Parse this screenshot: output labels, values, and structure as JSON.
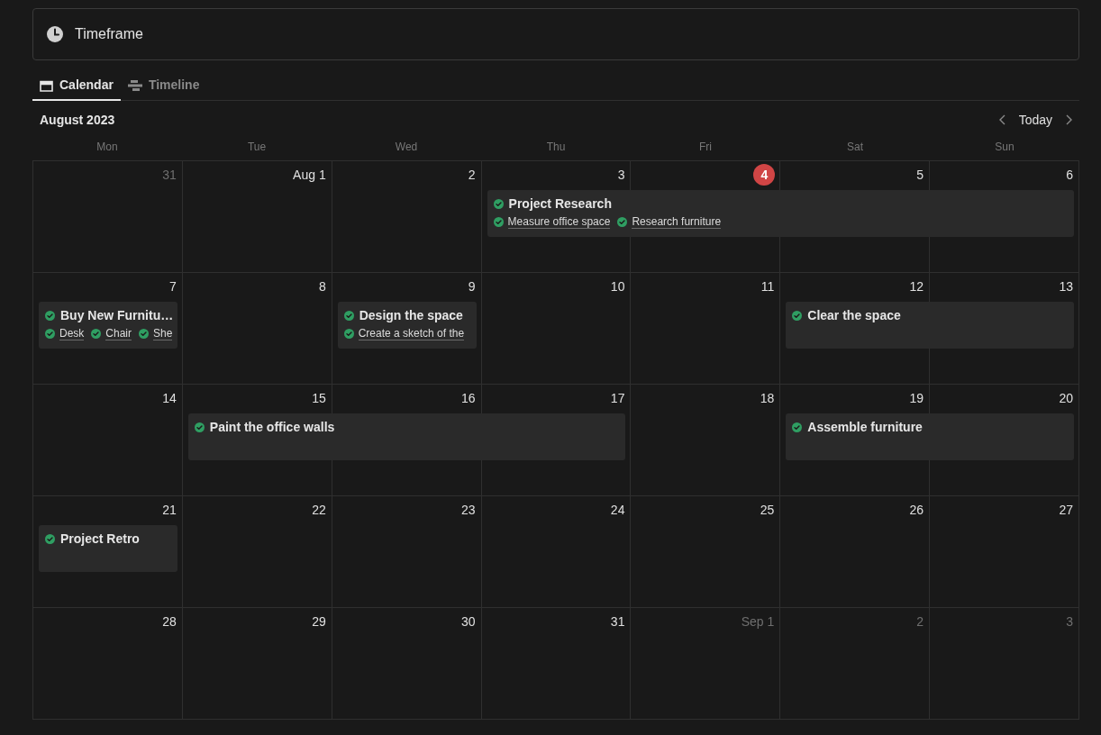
{
  "header": {
    "title": "Timeframe"
  },
  "tabs": [
    {
      "label": "Calendar",
      "kind": "calendar",
      "selected": true
    },
    {
      "label": "Timeline",
      "kind": "timeline",
      "selected": false
    }
  ],
  "month": "August 2023",
  "nav": {
    "today": "Today"
  },
  "weekdays": [
    "Mon",
    "Tue",
    "Wed",
    "Thu",
    "Fri",
    "Sat",
    "Sun"
  ],
  "weeks": [
    {
      "days": [
        {
          "label": "31",
          "muted": true,
          "today": false
        },
        {
          "label": "Aug 1",
          "muted": false,
          "today": false
        },
        {
          "label": "2",
          "muted": false,
          "today": false
        },
        {
          "label": "3",
          "muted": false,
          "today": false,
          "event": {
            "title": "Project Research",
            "done": true,
            "subtasks": [
              {
                "title": "Measure office space",
                "done": true
              },
              {
                "title": "Research furniture",
                "done": true
              }
            ]
          }
        },
        {
          "label": "4",
          "muted": false,
          "today": true,
          "continues": true
        },
        {
          "label": "5",
          "muted": false,
          "today": false,
          "continues": true
        },
        {
          "label": "6",
          "muted": false,
          "today": false,
          "continues": true
        }
      ]
    },
    {
      "days": [
        {
          "label": "7",
          "muted": false,
          "today": false,
          "event": {
            "title": "Buy New Furnitu…",
            "done": true,
            "subtasks": [
              {
                "title": "Desk",
                "done": true
              },
              {
                "title": "Chair",
                "done": true
              },
              {
                "title": "She",
                "done": true
              }
            ]
          }
        },
        {
          "label": "8",
          "muted": false,
          "today": false
        },
        {
          "label": "9",
          "muted": false,
          "today": false,
          "event": {
            "title": "Design the space",
            "done": true,
            "subtasks": [
              {
                "title": "Create a sketch of the",
                "done": true
              }
            ]
          }
        },
        {
          "label": "10",
          "muted": false,
          "today": false
        },
        {
          "label": "11",
          "muted": false,
          "today": false
        },
        {
          "label": "12",
          "muted": false,
          "today": false,
          "event": {
            "title": "Clear the space",
            "done": true
          }
        },
        {
          "label": "13",
          "muted": false,
          "today": false,
          "continues": true
        }
      ]
    },
    {
      "days": [
        {
          "label": "14",
          "muted": false,
          "today": false
        },
        {
          "label": "15",
          "muted": false,
          "today": false,
          "event": {
            "title": "Paint the office walls",
            "done": true
          }
        },
        {
          "label": "16",
          "muted": false,
          "today": false,
          "continues": true
        },
        {
          "label": "17",
          "muted": false,
          "today": false,
          "continues": true
        },
        {
          "label": "18",
          "muted": false,
          "today": false
        },
        {
          "label": "19",
          "muted": false,
          "today": false,
          "event": {
            "title": "Assemble furniture",
            "done": true
          }
        },
        {
          "label": "20",
          "muted": false,
          "today": false,
          "continues": true
        }
      ]
    },
    {
      "days": [
        {
          "label": "21",
          "muted": false,
          "today": false,
          "event": {
            "title": "Project Retro",
            "done": true
          }
        },
        {
          "label": "22",
          "muted": false,
          "today": false
        },
        {
          "label": "23",
          "muted": false,
          "today": false
        },
        {
          "label": "24",
          "muted": false,
          "today": false
        },
        {
          "label": "25",
          "muted": false,
          "today": false
        },
        {
          "label": "26",
          "muted": false,
          "today": false
        },
        {
          "label": "27",
          "muted": false,
          "today": false
        }
      ]
    },
    {
      "days": [
        {
          "label": "28",
          "muted": false,
          "today": false
        },
        {
          "label": "29",
          "muted": false,
          "today": false
        },
        {
          "label": "30",
          "muted": false,
          "today": false
        },
        {
          "label": "31",
          "muted": false,
          "today": false
        },
        {
          "label": "Sep 1",
          "muted": true,
          "today": false
        },
        {
          "label": "2",
          "muted": true,
          "today": false
        },
        {
          "label": "3",
          "muted": true,
          "today": false
        }
      ]
    }
  ]
}
